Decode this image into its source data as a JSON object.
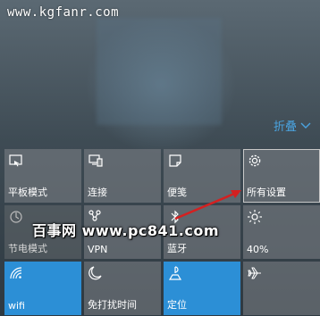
{
  "watermark_top": "www.kgfanr.com",
  "collapse_label": "折叠",
  "overlay_text": "百事网 www.pc841.com",
  "accent_color": "#2c8fd6",
  "tiles": [
    {
      "label": "平板模式",
      "icon": "tablet-mode-icon",
      "state": "off"
    },
    {
      "label": "连接",
      "icon": "connect-icon",
      "state": "off"
    },
    {
      "label": "便笺",
      "icon": "note-icon",
      "state": "off"
    },
    {
      "label": "所有设置",
      "icon": "gear-icon",
      "state": "highlighted"
    },
    {
      "label": "节电模式",
      "icon": "battery-saver-icon",
      "state": "disabled"
    },
    {
      "label": "VPN",
      "icon": "vpn-icon",
      "state": "off"
    },
    {
      "label": "蓝牙",
      "icon": "bluetooth-icon",
      "state": "off"
    },
    {
      "label": "40%",
      "icon": "brightness-icon",
      "state": "off"
    },
    {
      "label": "wifi",
      "icon": "wifi-icon",
      "state": "on"
    },
    {
      "label": "免打扰时间",
      "icon": "moon-icon",
      "state": "off"
    },
    {
      "label": "定位",
      "icon": "location-icon",
      "state": "on"
    },
    {
      "label": "",
      "icon": "airplane-icon",
      "state": "off"
    }
  ]
}
